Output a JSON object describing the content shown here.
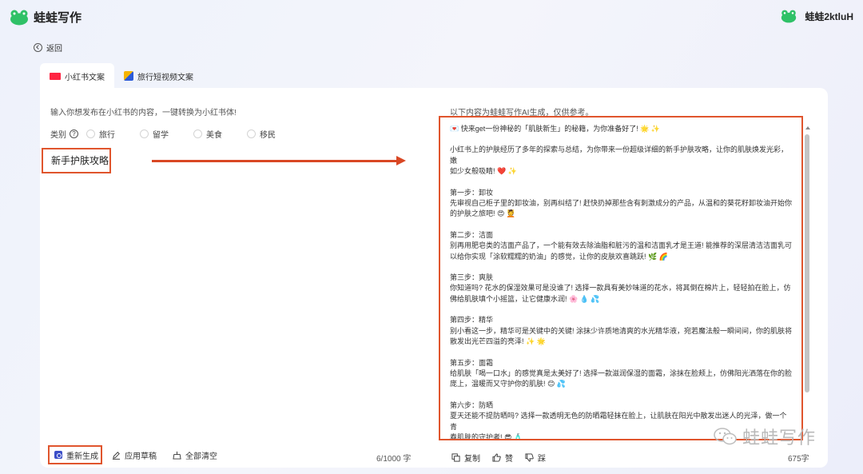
{
  "header": {
    "brand": "蛙蛙写作",
    "user": "蛙蛙2ktluH"
  },
  "nav": {
    "back_label": "返回"
  },
  "tabs": [
    {
      "label": "小红书文案",
      "active": true,
      "icon": "xiaohongshu-icon"
    },
    {
      "label": "旅行短视频文案",
      "active": false,
      "icon": "travel-video-icon"
    }
  ],
  "left": {
    "prompt": "输入你想发布在小红书的内容，一键转换为小红书体!",
    "category_label": "类别",
    "categories": [
      "旅行",
      "留学",
      "美食",
      "移民"
    ],
    "input_value": "新手护肤攻略",
    "actions": {
      "regenerate": "重新生成",
      "apply_draft": "应用草稿",
      "clear_all": "全部清空"
    },
    "word_count": "6/1000 字"
  },
  "right": {
    "ai_note": "以下内容为蛙蛙写作AI生成，仅供参考。",
    "output_blocks": [
      [
        "💌 快来get一份神秘的「肌肤新生」的秘籍，为你准备好了! 🌟 ✨"
      ],
      [
        "小红书上的护肤经历了多年的探索与总结，为你带来一份超级详细的新手护肤攻略，让你的肌肤焕发光彩，嫩",
        "如少女般吸睛! ❤️ ✨"
      ],
      [
        "第一步：卸妆",
        "先审视自己柜子里的卸妆油，别再纠结了! 赶快扔掉那些含有刺激成分的产品，从温和的葵花籽卸妆油开始你",
        "的护肤之旅吧! 😍 💆"
      ],
      [
        "第二步：洁面",
        "别再用肥皂类的洁面产品了，一个能有效去除油脂和脏污的温和洁面乳才是王道! 能推荐的深层清洁洁面乳可",
        "以给你实现「涂软糯糯的奶油」的感觉，让你的皮肤欢喜跳跃! 🌿 🌈"
      ],
      [
        "第三步：爽肤",
        "你知道吗? 花水的保湿效果可是没谁了! 选择一款具有美妙味道的花水，将其倒在棉片上，轻轻拍在脸上，仿",
        "佛给肌肤填个小摇篮，让它健康水润! 🌸 💧 💦"
      ],
      [
        "第四步：精华",
        "别小看这一步，精华可是关键中的关键! 涂抹少许质地清爽的水光精华液，宛若魔法般一瞬间间，你的肌肤将",
        "散发出光芒四溢的亮泽! ✨ 🌟"
      ],
      [
        "第五步：面霜",
        "给肌肤「喝一口水」的感觉真是太美好了! 选择一款滋润保湿的面霜，涂抹在脸颊上，仿佛阳光洒落在你的脸",
        "庞上，温暖而又守护你的肌肤! 😊 💦"
      ],
      [
        "第六步：防晒",
        "夏天还能不提防晒吗? 选择一款透明无色的防晒霜轻抹在脸上，让肌肤在阳光中散发出迷人的光泽，做一个青",
        "春肌肤的守护者! 😎 🧴"
      ]
    ],
    "actions": {
      "copy": "复制",
      "like": "赞",
      "dislike": "踩"
    },
    "word_count": "675字"
  },
  "watermark": "蛙蛙写作"
}
